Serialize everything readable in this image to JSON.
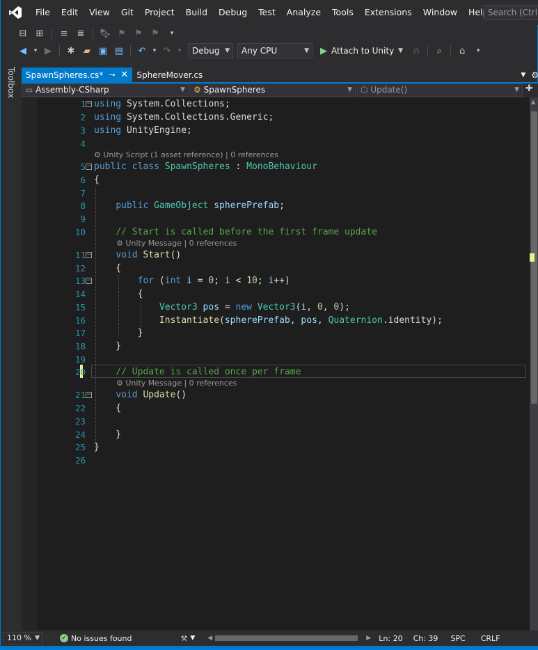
{
  "menu": [
    "File",
    "Edit",
    "View",
    "Git",
    "Project",
    "Build",
    "Debug",
    "Test",
    "Analyze",
    "Tools",
    "Extensions",
    "Window",
    "Help"
  ],
  "search_placeholder": "Search (Ctrl+Q)",
  "toolbar": {
    "config": "Debug",
    "platform": "Any CPU",
    "attach_label": "Attach to Unity"
  },
  "toolbox_label": "Toolbox",
  "tabs": [
    {
      "label": "SpawnSpheres.cs*",
      "active": true
    },
    {
      "label": "SphereMover.cs",
      "active": false
    }
  ],
  "nav": {
    "project": "Assembly-CSharp",
    "type": "SpawnSpheres",
    "member": "Update()"
  },
  "lens": {
    "class": "Unity Script (1 asset reference) | 0 references",
    "start": "Unity Message | 0 references",
    "update": "Unity Message | 0 references"
  },
  "line_numbers": [
    "1",
    "2",
    "3",
    "4",
    "5",
    "6",
    "7",
    "8",
    "9",
    "10",
    "11",
    "12",
    "13",
    "14",
    "15",
    "16",
    "17",
    "18",
    "19",
    "20",
    "21",
    "22",
    "23",
    "24",
    "25",
    "26"
  ],
  "status": {
    "zoom": "110 %",
    "issues": "No issues found",
    "line": "Ln: 20",
    "col": "Ch: 39",
    "spacing": "SPC",
    "eol": "CRLF"
  },
  "colors": {
    "accent": "#007acc",
    "keyword": "#569cd6",
    "type": "#4ec9b0",
    "comment": "#57a64a",
    "change": "#efef91"
  }
}
